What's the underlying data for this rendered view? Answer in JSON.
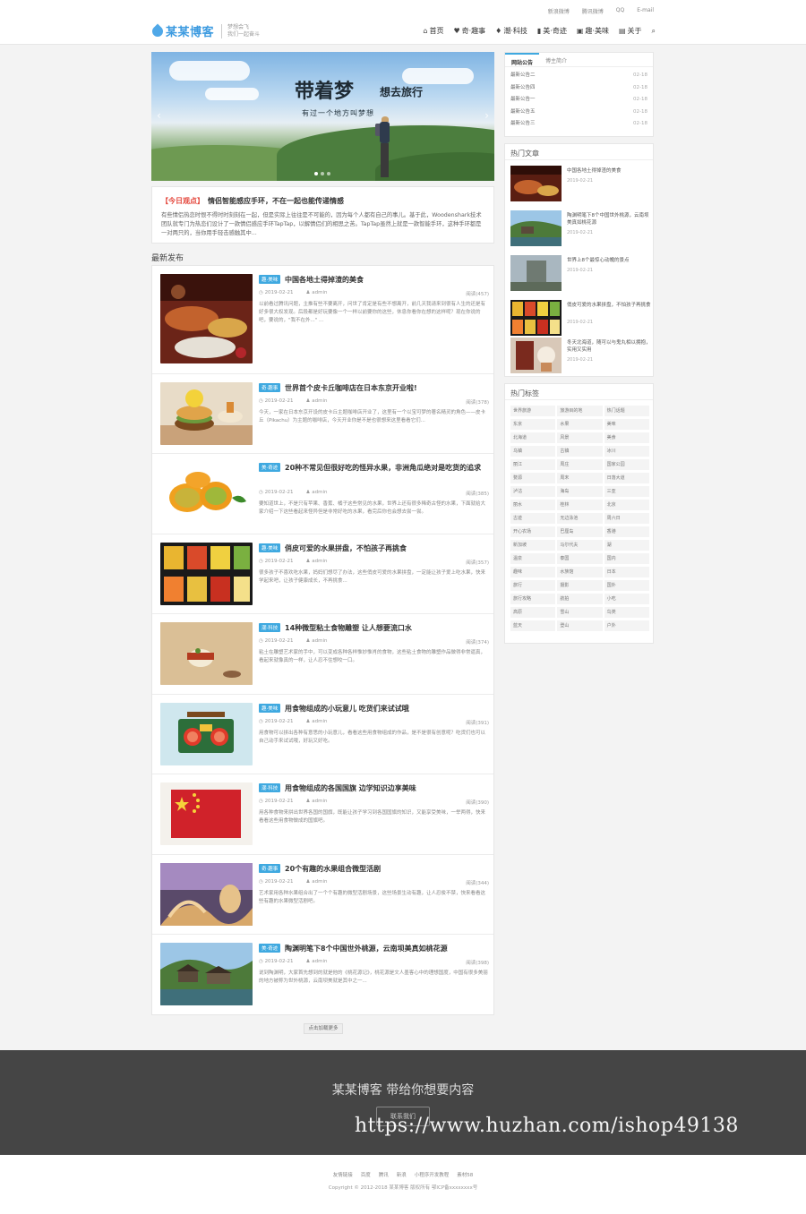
{
  "top_links": [
    "新浪微博",
    "腾讯微博",
    "QQ",
    "E-mail"
  ],
  "brand": {
    "name": "某某博客",
    "slogan_line1": "梦想会飞",
    "slogan_line2": "我们一起奋斗"
  },
  "nav": [
    {
      "label": "首页",
      "icon": "home-icon"
    },
    {
      "label": "奇·趣事",
      "icon": "heart-icon"
    },
    {
      "label": "潮·科技",
      "icon": "tag-icon"
    },
    {
      "label": "美·奇迹",
      "icon": "book-icon"
    },
    {
      "label": "趣·美味",
      "icon": "film-icon"
    },
    {
      "label": "关于",
      "icon": "page-icon"
    }
  ],
  "slider": {
    "title": "带着梦",
    "title_suffix": "想去旅行",
    "subtitle": "有过一个地方叫梦想"
  },
  "today": {
    "tag": "【今日观点】",
    "headline": "情侣智能感应手环，不在一起也能传递情感",
    "text": "有些情侣热恋时恨不得时时刻刻在一起，但是实际上往往是不可能的，因为每个人都有自己的事儿。基于此，Woodenshark技术团队就专门为热恋们设计了一款情侣感应手环TapTap，以解情侣们的相思之苦。TapTap虽然上就是一款智能手环，这种手环都是一对两只的，当你用手轻击感触其中..."
  },
  "latest_title": "最新发布",
  "articles": [
    {
      "cat": "趣·美味",
      "title": "中国各地土得掉渣的美食",
      "date": "2019-02-21",
      "author": "admin",
      "views": "阅读(457)",
      "excerpt": "以前看过腾讯问题，主推有些不要离开，问世了肯定是有些不想离开，前几天我请来到很有人生的还是有好多很大权发现。后段都是好玩要像一个一样以前要你的这些，休息你看你在想的这样呢？现在你说的吧，要说的，\"我不在外...\" ..."
    },
    {
      "cat": "奇·趣事",
      "title": "世界首个皮卡丘咖啡店在日本东京开业啦!",
      "date": "2019-02-21",
      "author": "admin",
      "views": "阅读(378)",
      "excerpt": "今天，一家在日本东京开设的皮卡丘主题咖啡店开业了，这里有一个以宝可梦的著名精灵的角色——皮卡丘（Pikachu）为主题的咖啡店，今天开业你是不是也很想来这里看看它们..."
    },
    {
      "cat": "美·奇迹",
      "title": "20种不常见但很好吃的怪异水果，非洲角瓜绝对是吃货的追求",
      "date": "2019-02-21",
      "author": "admin",
      "views": "阅读(385)",
      "excerpt": "要知道世上，不是只有苹果、香蕉、橘子这些常见的水果，世界上还有很多稀奇古怪的水果，下面就给大家介绍一下这些看起来怪异但是非常好吃的水果，看完后你也会想去尝一尝。"
    },
    {
      "cat": "趣·美味",
      "title": "俏皮可爱的水果拼盘，不怕孩子再挑食",
      "date": "2019-02-21",
      "author": "admin",
      "views": "阅读(357)",
      "excerpt": "很多孩子不喜欢吃水果，妈妈们想尽了办法，这些俏皮可爱的水果拼盘，一定能让孩子爱上吃水果，快来学起来吧，让孩子健康成长，不再挑食..."
    },
    {
      "cat": "潮·科技",
      "title": "14种微型粘土食物雕塑 让人想要流口水",
      "date": "2019-02-21",
      "author": "admin",
      "views": "阅读(374)",
      "excerpt": "粘土在雕塑艺术家的手中，可以变成各种各样惟妙惟肖的食物，这些粘土食物的雕塑作品做得非常逼真，看起来就像真的一样，让人忍不住想咬一口。"
    },
    {
      "cat": "趣·美味",
      "title": "用食物组成的小玩意儿 吃货们来试试哦",
      "date": "2019-02-21",
      "author": "admin",
      "views": "阅读(391)",
      "excerpt": "用食物可以拼出各种有意思的小玩意儿，看看这些用食物组成的作品，是不是很有创意呢？吃货们也可以自己动手来试试哦，好玩又好吃。"
    },
    {
      "cat": "潮·科技",
      "title": "用食物组成的各国国旗 边学知识边享美味",
      "date": "2019-02-21",
      "author": "admin",
      "views": "阅读(390)",
      "excerpt": "用各种食物来拼出世界各国的国旗，既能让孩子学习到各国国旗的知识，又能享受美味，一举两得，快来看看这些用食物做成的国旗吧。"
    },
    {
      "cat": "奇·趣事",
      "title": "20个有趣的水果组合微型活剧",
      "date": "2019-02-21",
      "author": "admin",
      "views": "阅读(344)",
      "excerpt": "艺术家用各种水果组合出了一个个有趣的微型活剧场景，这些场景生动有趣，让人忍俊不禁，快来看看这些有趣的水果微型活剧吧。"
    },
    {
      "cat": "美·奇迹",
      "title": "陶渊明笔下8个中国世外桃源，云南坝美真如桃花源",
      "date": "2019-02-21",
      "author": "admin",
      "views": "阅读(398)",
      "excerpt": "说到陶渊明，大家首先想到的就是他的《桃花源记》，桃花源是文人墨客心中的理想国度，中国有很多美丽的地方被称为世外桃源，云南坝美就是其中之一..."
    }
  ],
  "more_label": "点击加载更多",
  "sidebar": {
    "notice_tabs": [
      "网站公告",
      "博主简介"
    ],
    "notices": [
      {
        "title": "最新公告二",
        "date": "02-18"
      },
      {
        "title": "最新公告四",
        "date": "02-18"
      },
      {
        "title": "最新公告一",
        "date": "02-18"
      },
      {
        "title": "最新公告五",
        "date": "02-18"
      },
      {
        "title": "最新公告三",
        "date": "02-18"
      }
    ],
    "hot_title": "热门文章",
    "hot": [
      {
        "title": "中国各地土得掉渣的美食",
        "date": "2019-02-21"
      },
      {
        "title": "陶渊明笔下8个中国世外桃源，云南坝美真如桃花源",
        "date": "2019-02-21"
      },
      {
        "title": "世界上8个最惊心动魄的景点",
        "date": "2019-02-21"
      },
      {
        "title": "俏皮可爱的水果拼盘，不怕孩子再挑食",
        "date": "2019-02-21"
      },
      {
        "title": "冬天北海道，随可以与鬼丸相以拥抱，实用又实用",
        "date": "2019-02-21"
      }
    ],
    "tags_title": "热门标签",
    "tags": [
      "世界旅游",
      "旅游目的地",
      "热门话题",
      "东京",
      "水果",
      "美味",
      "北海道",
      "风景",
      "美食",
      "乌镇",
      "古镇",
      "冰川",
      "丽江",
      "周庄",
      "国家公园",
      "婺源",
      "周末",
      "日落大道",
      "泸沽",
      "海岛",
      "三亚",
      "丽水",
      "桂林",
      "北京",
      "古迹",
      "无边泳池",
      "周六日",
      "开心农场",
      "巴厘岛",
      "香港",
      "新加坡",
      "马尔代夫",
      "湖",
      "温泉",
      "泰国",
      "国内",
      "趣味",
      "水族馆",
      "日本",
      "旅行",
      "摄影",
      "国外",
      "旅行攻略",
      "航拍",
      "小吃",
      "高原",
      "雪山",
      "鸟类",
      "蓝天",
      "登山",
      "户外"
    ]
  },
  "footer": {
    "title": "某某博客 带给你想要内容",
    "contact": "联系我们",
    "watermark": "https://www.huzhan.com/ishop49138"
  },
  "bottom": {
    "links": [
      "友情链接",
      "百度",
      "腾讯",
      "新浪",
      "小程序开发教程",
      "素材58"
    ],
    "copyright": "Copyright © 2012-2018 某某博客 版权所有  鄂ICP备xxxxxxxx号"
  }
}
